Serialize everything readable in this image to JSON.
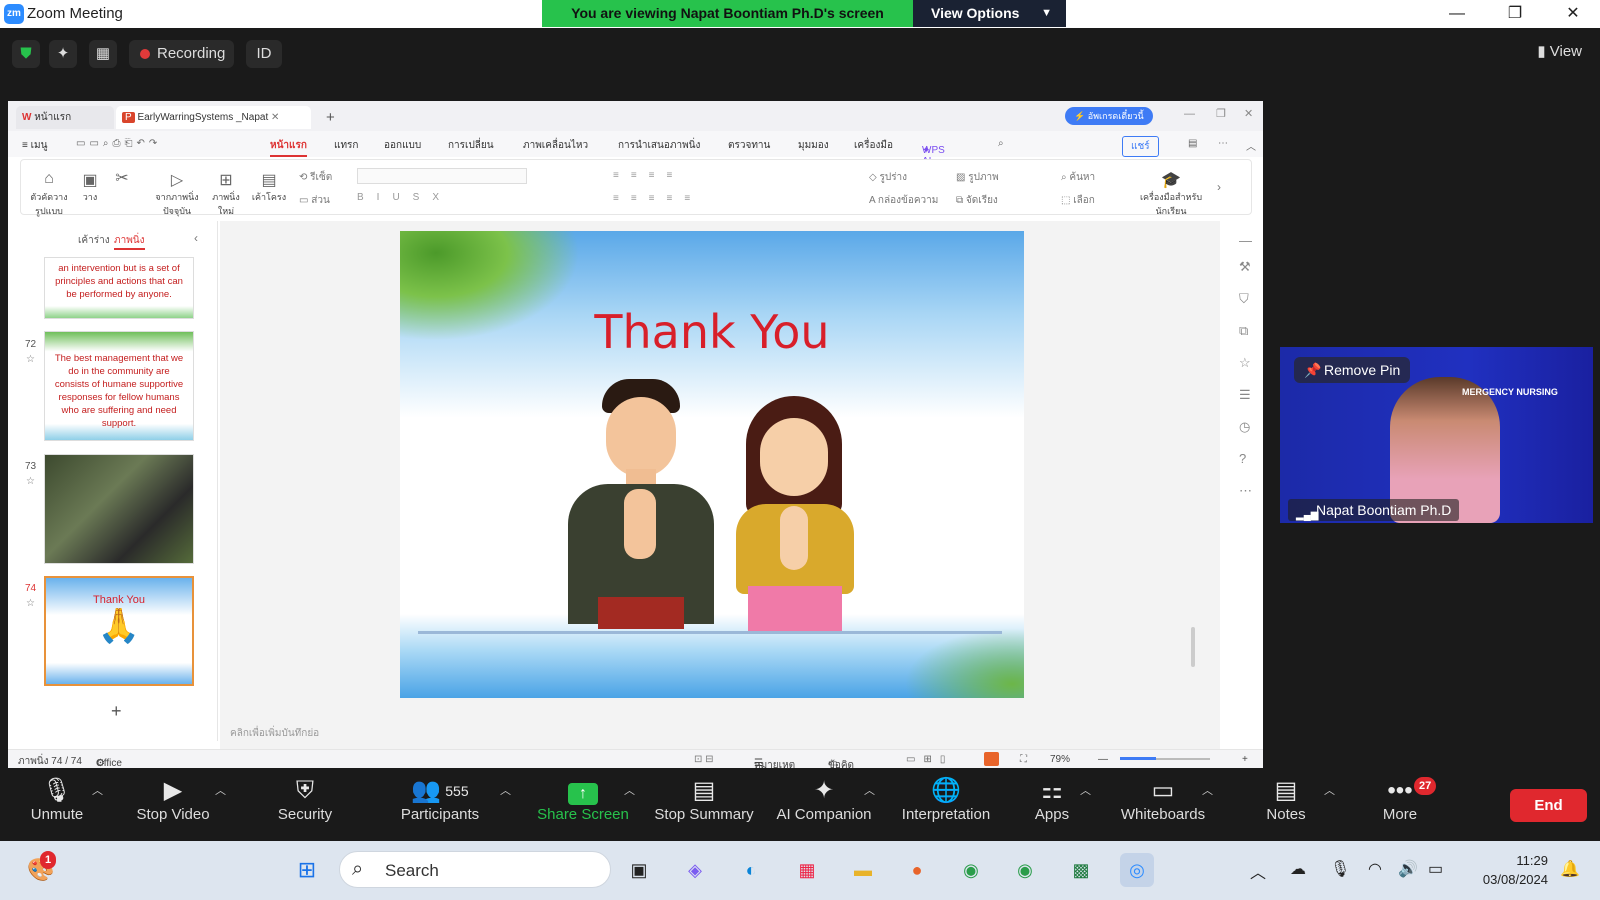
{
  "window": {
    "title": "Zoom Meeting",
    "app_logo": "zm"
  },
  "share_banner": {
    "text": "You are viewing Napat Boontiam Ph.D's screen",
    "view_options": "View Options"
  },
  "topbar": {
    "recording": "Recording",
    "id_label": "ID",
    "view": "View"
  },
  "wps": {
    "tabs": [
      {
        "label": "หน้าแรก"
      },
      {
        "label": "EarlyWarringSystems _Napat"
      }
    ],
    "ai_button": "อัพเกรดเดี๋ยวนี้",
    "menu": [
      "≡ เมนู",
      "หน้าแรก",
      "แทรก",
      "ออกแบบ",
      "การเปลี่ยน",
      "ภาพเคลื่อนไหว",
      "การนำเสนอภาพนิ่ง",
      "ตรวจทาน",
      "มุมมอง",
      "เครื่องมือ",
      "WPS AI"
    ],
    "share_label": "แชร์",
    "ribbon": {
      "format_painter": "ตัวคัดวาง รูปแบบ",
      "paste": "วาง",
      "from_current": "จากภาพนิ่ง ปัจจุบัน",
      "new_slide": "ภาพนิ่ง ใหม่",
      "layout": "เค้าโครง",
      "reset": "รีเซ็ต",
      "section": "ส่วน",
      "shape": "รูปร่าง",
      "picture": "รูปภาพ",
      "textbox": "กล่องข้อความ",
      "arrange": "จัดเรียง",
      "find": "ค้นหา",
      "select": "เลือก",
      "teacher_tools": "เครื่องมือสำหรับนักเรียน"
    },
    "panel_tabs": {
      "outline": "เค้าร่าง",
      "slides": "ภาพนิ่ง"
    },
    "thumbs": [
      {
        "num": "",
        "text": "an intervention but is a set of principles and actions that can be performed by anyone."
      },
      {
        "num": "72",
        "text": "The best management that we do in the community are consists of humane supportive responses for fellow humans who are suffering and need support."
      },
      {
        "num": "73",
        "text": ""
      },
      {
        "num": "74",
        "text": "Thank You"
      }
    ],
    "slide_title": "Thank You",
    "notes_placeholder": "คลิกเพื่อเพิ่มบันทึกย่อ",
    "status": {
      "slide_count": "ภาพนิ่ง 74 / 74",
      "theme": "Office Theme",
      "notes": "หมายเหตุ",
      "comments": "ข้อคิดเห็น",
      "zoom": "79%"
    }
  },
  "video": {
    "remove_pin": "Remove Pin",
    "participant": "Napat Boontiam Ph.D"
  },
  "toolbar": {
    "unmute": "Unmute",
    "stop_video": "Stop Video",
    "security": "Security",
    "participants": "Participants",
    "participants_count": "555",
    "share_screen": "Share Screen",
    "stop_summary": "Stop Summary",
    "ai_companion": "AI Companion",
    "interpretation": "Interpretation",
    "apps": "Apps",
    "whiteboards": "Whiteboards",
    "notes": "Notes",
    "more": "More",
    "more_badge": "27",
    "end": "End"
  },
  "taskbar": {
    "search": "Search",
    "time": "11:29",
    "date": "03/08/2024",
    "notif_badge": "1"
  },
  "colors": {
    "share_green": "#27c24c",
    "end_red": "#e0282e",
    "accent_blue": "#2d8cff",
    "slide_red": "#d81f2a"
  }
}
